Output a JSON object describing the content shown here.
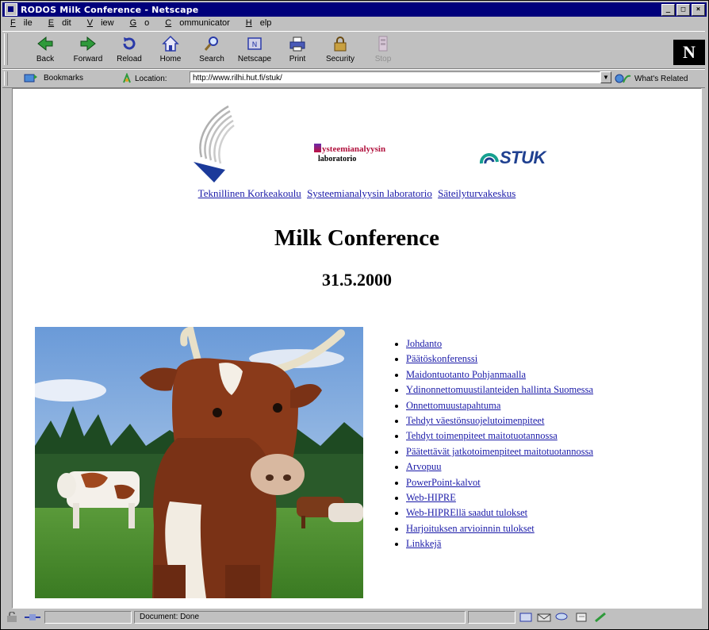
{
  "window": {
    "title": "RODOS Milk Conference - Netscape"
  },
  "menu": [
    {
      "key": "F",
      "rest": "ile"
    },
    {
      "key": "E",
      "rest": "dit"
    },
    {
      "key": "V",
      "rest": "iew"
    },
    {
      "key": "G",
      "rest": "o"
    },
    {
      "key": "C",
      "rest": "ommunicator"
    },
    {
      "key": "H",
      "rest": "elp"
    }
  ],
  "toolbar": {
    "back": "Back",
    "forward": "Forward",
    "reload": "Reload",
    "home": "Home",
    "search": "Search",
    "netscape": "Netscape",
    "print": "Print",
    "security": "Security",
    "stop": "Stop",
    "brand": "N"
  },
  "locbar": {
    "bookmarks": "Bookmarks",
    "location_label": "Location:",
    "url": "http://www.rilhi.hut.fi/stuk/",
    "related": "What's Related"
  },
  "page": {
    "sal_logo_line1": "ysteemianalyysin",
    "sal_logo_line2": "laboratorio",
    "stuk_logo": "STUK",
    "org_links": [
      "Teknillinen Korkeakoulu",
      "Systeemianalyysin laboratorio",
      "Säteilyturvakeskus"
    ],
    "title": "Milk Conference",
    "date": "31.5.2000",
    "nav_links": [
      "Johdanto",
      "Päätöskonferenssi",
      "Maidontuotanto Pohjanmaalla",
      "Ydinonnettomuustilanteiden hallinta Suomessa",
      "Onnettomuustapahtuma",
      "Tehdyt väestönsuojelutoimenpiteet",
      "Tehdyt toimenpiteet maitotuotannossa",
      "Päätettävät jatkotoimenpiteet maitotuotannossa",
      "Arvopuu",
      "PowerPoint-kalvot",
      "Web-HIPRE",
      "Web-HIPREllä saadut tulokset",
      "Harjoituksen arvioinnin tulokset",
      "Linkkejä"
    ]
  },
  "status": {
    "text": "Document: Done"
  },
  "colors": {
    "titlebar": "#00007b",
    "link": "#1a1aa8",
    "chrome": "#c0c0c0"
  }
}
